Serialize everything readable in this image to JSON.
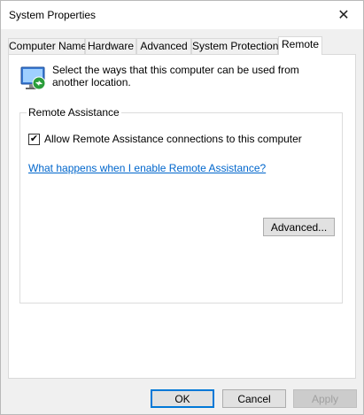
{
  "window": {
    "title": "System Properties",
    "close_glyph": "✕"
  },
  "tabs": [
    {
      "label": "Computer Name"
    },
    {
      "label": "Hardware"
    },
    {
      "label": "Advanced"
    },
    {
      "label": "System Protection"
    },
    {
      "label": "Remote",
      "active": true
    }
  ],
  "intro": {
    "text": "Select the ways that this computer can be used from another location.",
    "icon": "remote-desktop-icon"
  },
  "remote_assistance": {
    "group_label": "Remote Assistance",
    "checkbox_label": "Allow Remote Assistance connections to this computer",
    "checked": true,
    "check_glyph": "✔",
    "help_link": "What happens when I enable Remote Assistance?",
    "advanced_button": "Advanced..."
  },
  "footer": {
    "ok": "OK",
    "cancel": "Cancel",
    "apply": "Apply"
  },
  "colors": {
    "accent": "#0078d7",
    "link": "#0066cc"
  }
}
